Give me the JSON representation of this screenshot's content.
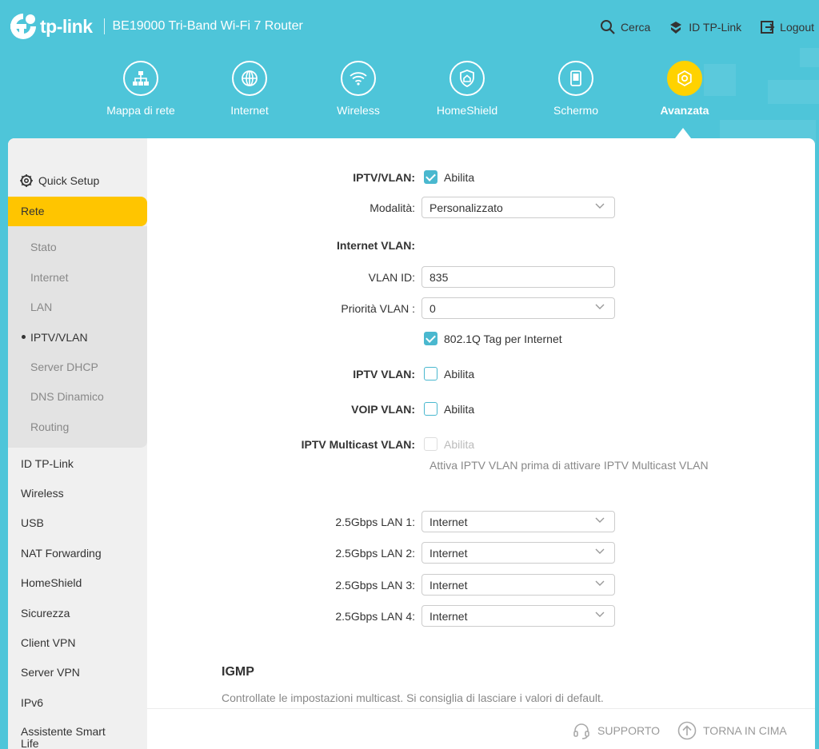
{
  "header": {
    "brand": "tp-link",
    "model": "BE19000 Tri-Band Wi-Fi 7 Router",
    "actions": [
      {
        "label": "Cerca",
        "icon": "search-icon"
      },
      {
        "label": "ID TP-Link",
        "icon": "tplink-id-icon"
      },
      {
        "label": "Logout",
        "icon": "logout-icon"
      }
    ]
  },
  "nav": {
    "items": [
      {
        "label": "Mappa di rete",
        "icon": "network-map-icon"
      },
      {
        "label": "Internet",
        "icon": "globe-icon"
      },
      {
        "label": "Wireless",
        "icon": "wifi-icon"
      },
      {
        "label": "HomeShield",
        "icon": "homeshield-icon"
      },
      {
        "label": "Schermo",
        "icon": "screen-icon"
      },
      {
        "label": "Avanzata",
        "icon": "advanced-gear-icon",
        "active": true
      }
    ]
  },
  "sidebar": {
    "quick_setup": "Quick Setup",
    "active_section": "Rete",
    "sub_items": [
      "Stato",
      "Internet",
      "LAN",
      "IPTV/VLAN",
      "Server DHCP",
      "DNS Dinamico",
      "Routing"
    ],
    "active_sub": "IPTV/VLAN",
    "items": [
      "ID TP-Link",
      "Wireless",
      "USB",
      "NAT Forwarding",
      "HomeShield",
      "Sicurezza",
      "Client VPN",
      "Server VPN",
      "IPv6",
      "Assistente Smart Life"
    ]
  },
  "form": {
    "iptv_vlan_label": "IPTV/VLAN:",
    "iptv_vlan_enable": "Abilita",
    "mode_label": "Modalità:",
    "mode_value": "Personalizzato",
    "internet_vlan_label": "Internet VLAN:",
    "vlan_id_label": "VLAN ID:",
    "vlan_id_value": "835",
    "vlan_priority_label": "Priorità VLAN :",
    "vlan_priority_value": "0",
    "tag_label": "802.1Q Tag per Internet",
    "iptv_vlan2_label": "IPTV VLAN:",
    "iptv_vlan2_enable": "Abilita",
    "voip_vlan_label": "VOIP VLAN:",
    "voip_vlan_enable": "Abilita",
    "multicast_label": "IPTV Multicast VLAN:",
    "multicast_enable": "Abilita",
    "multicast_hint": "Attiva IPTV VLAN prima di attivare IPTV Multicast VLAN",
    "lan_ports": [
      {
        "label": "2.5Gbps LAN 1:",
        "value": "Internet"
      },
      {
        "label": "2.5Gbps LAN 2:",
        "value": "Internet"
      },
      {
        "label": "2.5Gbps LAN 3:",
        "value": "Internet"
      },
      {
        "label": "2.5Gbps LAN 4:",
        "value": "Internet"
      }
    ]
  },
  "igmp": {
    "title": "IGMP",
    "description": "Controllate le impostazioni multicast. Si consiglia di lasciare i valori di default."
  },
  "footer": {
    "support": "SUPPORTO",
    "back_to_top": "TORNA IN CIMA"
  },
  "colors": {
    "header_bg": "#4ec5d9",
    "accent_yellow": "#ffc500",
    "checkbox_teal": "#4ab8cf"
  }
}
